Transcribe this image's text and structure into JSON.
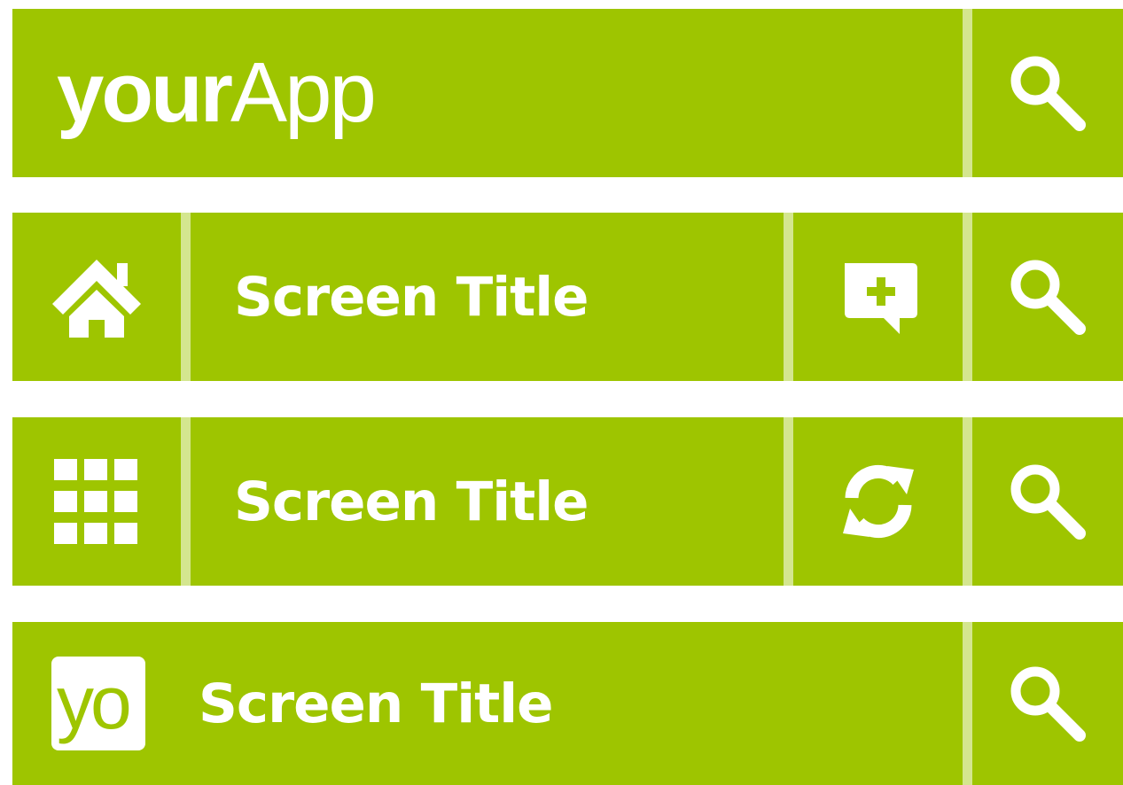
{
  "theme": {
    "bar_color": "#9ec500",
    "divider_color": "#d4e68f",
    "text_color": "#ffffff"
  },
  "bar1": {
    "brand_bold": "your",
    "brand_light": "App",
    "search_icon": "search-icon"
  },
  "bar2": {
    "nav_icon": "home-icon",
    "title": "Screen Title",
    "action_icon": "add-comment-icon",
    "search_icon": "search-icon"
  },
  "bar3": {
    "nav_icon": "grid-icon",
    "title": "Screen Title",
    "action_icon": "refresh-icon",
    "search_icon": "search-icon"
  },
  "bar4": {
    "logo_text": "yo",
    "title": "Screen Title",
    "search_icon": "search-icon"
  }
}
